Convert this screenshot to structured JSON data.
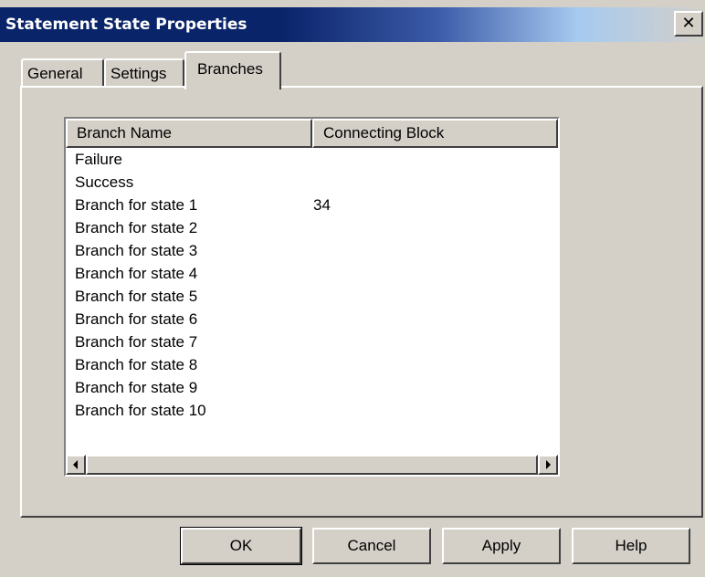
{
  "window": {
    "title": "Statement State Properties",
    "close_glyph": "✕",
    "accent_color": "#0a246a"
  },
  "tabs": [
    {
      "label": "General",
      "selected": false
    },
    {
      "label": "Settings",
      "selected": false
    },
    {
      "label": "Branches",
      "selected": true
    }
  ],
  "list": {
    "columns": [
      "Branch Name",
      "Connecting Block"
    ],
    "rows": [
      {
        "name": "Failure",
        "block": ""
      },
      {
        "name": "Success",
        "block": ""
      },
      {
        "name": "Branch for state 1",
        "block": "34"
      },
      {
        "name": "Branch for state 2",
        "block": ""
      },
      {
        "name": "Branch for state 3",
        "block": ""
      },
      {
        "name": "Branch for state 4",
        "block": ""
      },
      {
        "name": "Branch for state 5",
        "block": ""
      },
      {
        "name": "Branch for state 6",
        "block": ""
      },
      {
        "name": "Branch for state 7",
        "block": ""
      },
      {
        "name": "Branch for state 8",
        "block": ""
      },
      {
        "name": "Branch for state 9",
        "block": ""
      },
      {
        "name": "Branch for state 10",
        "block": ""
      }
    ],
    "scroll_left_icon": "arrow-left-icon",
    "scroll_right_icon": "arrow-right-icon"
  },
  "buttons": {
    "ok": "OK",
    "cancel": "Cancel",
    "apply": "Apply",
    "help": "Help"
  }
}
